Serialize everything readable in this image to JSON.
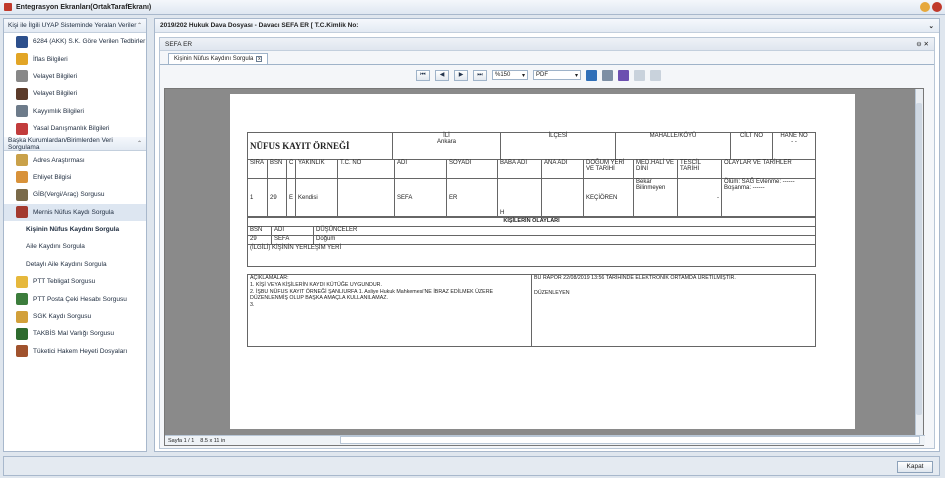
{
  "window": {
    "title": "Entegrasyon Ekranları(OrtakTarafEkranı)"
  },
  "left": {
    "section1": "Kişi ile İlgili UYAP Sisteminde Yeralan Veriler",
    "items1": [
      "6284 (AKK) S.K. Göre Verilen Tedbirler",
      "İflas Bilgileri",
      "Velayet Bilgileri",
      "Velayet Bilgileri",
      "Kayyımlık Bilgileri",
      "Yasal Danışmanlık Bilgileri"
    ],
    "section2": "Başka Kurumlardan/Birimlerden Veri Sorgulama",
    "items2": [
      "Adres Araştırması",
      "Ehliyet Bilgisi",
      "GİB(Vergi/Araç) Sorgusu",
      "Mernis Nüfus Kaydı Sorgula"
    ],
    "subitems": [
      "Kişinin Nüfus Kaydını Sorgula",
      "Aile Kaydını Sorgula",
      "Detaylı Aile Kaydını Sorgula"
    ],
    "items3": [
      "PTT Tebligat Sorgusu",
      "PTT Posta Çeki Hesabı Sorgusu",
      "SGK Kaydı Sorgusu",
      "TAKBİS Mal Varlığı Sorgusu",
      "Tüketici Hakem Heyeti Dosyaları"
    ]
  },
  "right": {
    "header": "2019/202 Hukuk Dava Dosyası - Davacı SEFA ER [ T.C.Kimlik No:",
    "inner_title": "SEFA ER",
    "tab": "Kişinin Nüfus Kaydını Sorgula",
    "zoom": "%150",
    "format": "PDF",
    "status": "Sayfa 1 / 1",
    "page_size": "8.5 x 11 in"
  },
  "doc": {
    "title": "NÜFUS KAYIT ÖRNEĞİ",
    "il_label": "İLİ",
    "il": "Ankara",
    "ilce_label": "İLÇESİ",
    "mahalle_label": "MAHALLE/KÖYÜ",
    "cilt_label": "CİLT NO",
    "hane_label": "HANE NO",
    "hane": "- -",
    "headers": [
      "SIRA",
      "BSN",
      "C",
      "YAKINLIK",
      "T.C. NO",
      "ADI",
      "SOYADI",
      "BABA ADI",
      "ANA ADI",
      "DOĞUM YERİ VE TARİHİ",
      "MED.HALİ VE DİNİ",
      "TESCİL TARİHİ",
      "OLAYLAR VE TARİHLER"
    ],
    "row": [
      "1",
      "29",
      "E",
      "Kendisi",
      "",
      "SEFA",
      "ER",
      "H",
      "",
      "KEÇİÖREN",
      "Bekar Bilinmeyen",
      "-",
      "Ölüm: SAĞ Evlenme: ------ Boşanma: ------"
    ],
    "olaylar_title": "KİŞİLERİN OLAYLARI",
    "olay_headers": [
      "BSN",
      "ADI",
      "DÜŞÜNCELER"
    ],
    "olay_row": [
      "29",
      "SEFA",
      "Doğum"
    ],
    "yerlesim": "(İLGİLİ) KİŞİNİN YERLEŞİM YERİ",
    "aciklama": "AÇIKLAMALAR:\n1. KİŞİ VEYA KİŞİLERİN KAYDI KÜTÜĞE UYGUNDUR.\n2. İŞBU NÜFUS KAYIT ÖRNEĞİ ŞANLIURFA 1. Asliye Hukuk Mahkemesi'NE İBRAZ EDİLMEK ÜZERE DÜZENLENMİŞ OLUP BAŞKA AMAÇLA KULLANILAMAZ.\n3.",
    "rapor": "BU RAPOR 22/08/2019 13:56 TARİHİNDE ELEKTRONİK ORTAMDA ÜRETİLMİŞTİR.",
    "duzenleyen": "DÜZENLEYEN"
  },
  "bottom": {
    "close": "Kapat"
  }
}
